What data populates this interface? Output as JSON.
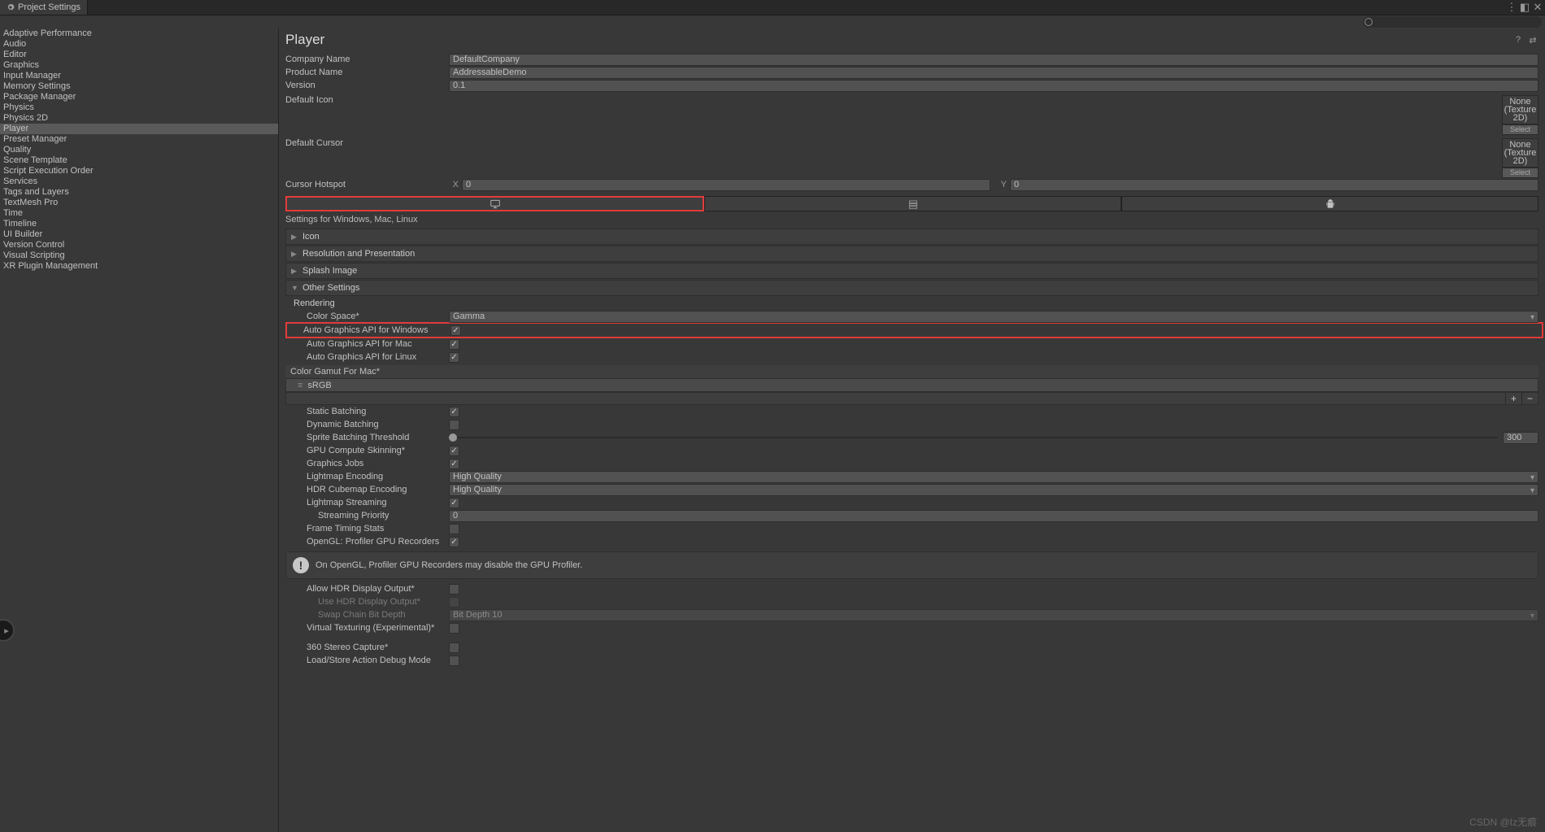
{
  "tab": "Project Settings",
  "sidebar": {
    "items": [
      "Adaptive Performance",
      "Audio",
      "Editor",
      "Graphics",
      "Input Manager",
      "Memory Settings",
      "Package Manager",
      "Physics",
      "Physics 2D",
      "Player",
      "Preset Manager",
      "Quality",
      "Scene Template",
      "Script Execution Order",
      "Services",
      "Tags and Layers",
      "TextMesh Pro",
      "Time",
      "Timeline",
      "UI Builder",
      "Version Control",
      "Visual Scripting",
      "XR Plugin Management"
    ],
    "selected": "Player"
  },
  "header": {
    "title": "Player"
  },
  "general": {
    "companyName_label": "Company Name",
    "companyName": "DefaultCompany",
    "productName_label": "Product Name",
    "productName": "AddressableDemo",
    "version_label": "Version",
    "version": "0.1",
    "defaultIcon_label": "Default Icon",
    "defaultCursor_label": "Default Cursor",
    "none_label": "None",
    "texture2d_label": "(Texture 2D)",
    "select_label": "Select",
    "cursorHotspot_label": "Cursor Hotspot",
    "x": "0",
    "y": "0"
  },
  "platformSettings_label": "Settings for Windows, Mac, Linux",
  "foldouts": {
    "icon": "Icon",
    "resolution": "Resolution and Presentation",
    "splash": "Splash Image",
    "other": "Other Settings"
  },
  "rendering": {
    "title": "Rendering",
    "colorSpace_label": "Color Space*",
    "colorSpace": "Gamma",
    "autoGfxWin_label": "Auto Graphics API  for Windows",
    "autoGfxMac_label": "Auto Graphics API  for Mac",
    "autoGfxLinux_label": "Auto Graphics API  for Linux",
    "colorGamut_label": "Color Gamut For Mac*",
    "sRGB": "sRGB",
    "staticBatching_label": "Static Batching",
    "dynamicBatching_label": "Dynamic Batching",
    "spriteBatching_label": "Sprite Batching Threshold",
    "spriteBatching_val": "300",
    "gpuSkinning_label": "GPU Compute Skinning*",
    "graphicsJobs_label": "Graphics Jobs",
    "lightmapEncoding_label": "Lightmap Encoding",
    "lightmapEncoding": "High Quality",
    "hdrCubemap_label": "HDR Cubemap Encoding",
    "hdrCubemap": "High Quality",
    "lightmapStreaming_label": "Lightmap Streaming",
    "streamingPriority_label": "Streaming Priority",
    "streamingPriority": "0",
    "frameTiming_label": "Frame Timing Stats",
    "openglProfiler_label": "OpenGL: Profiler GPU Recorders",
    "info": "On OpenGL, Profiler GPU Recorders may disable the GPU Profiler.",
    "allowHDR_label": "Allow HDR Display Output*",
    "useHDR_label": "Use HDR Display Output*",
    "swapChain_label": "Swap Chain Bit Depth",
    "swapChain": "Bit Depth 10",
    "virtualTex_label": "Virtual Texturing (Experimental)*",
    "stereo360_label": "360 Stereo Capture*",
    "loadStore_label": "Load/Store Action Debug Mode"
  },
  "watermark": "CSDN @Iz无痕"
}
